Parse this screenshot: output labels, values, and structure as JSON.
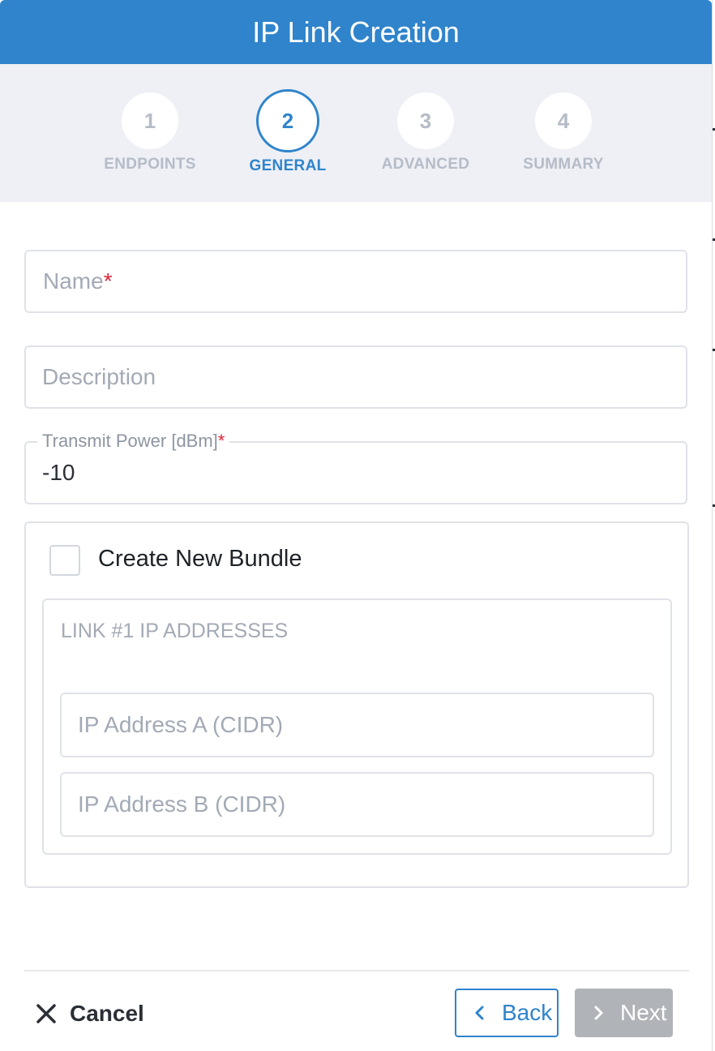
{
  "dialog": {
    "title": "IP Link Creation"
  },
  "stepper": {
    "steps": [
      {
        "number": "1",
        "label": "ENDPOINTS",
        "active": false
      },
      {
        "number": "2",
        "label": "GENERAL",
        "active": true
      },
      {
        "number": "3",
        "label": "ADVANCED",
        "active": false
      },
      {
        "number": "4",
        "label": "SUMMARY",
        "active": false
      }
    ]
  },
  "form": {
    "name": {
      "placeholder": "Name",
      "required_mark": "*",
      "value": ""
    },
    "description": {
      "placeholder": "Description",
      "value": ""
    },
    "transmit_power": {
      "label": "Transmit Power [dBm]",
      "required_mark": "*",
      "value": "-10"
    },
    "bundle": {
      "checkbox_label": "Create New Bundle",
      "checked": false
    },
    "ip_addresses": {
      "title": "LINK #1 IP ADDRESSES",
      "address_a_placeholder": "IP Address A (CIDR)",
      "address_b_placeholder": "IP Address B (CIDR)"
    }
  },
  "footer": {
    "cancel_label": "Cancel",
    "back_label": "Back",
    "next_label": "Next",
    "cancel_icon": "close-icon",
    "back_icon": "chevron-left-icon",
    "next_icon": "chevron-right-icon"
  },
  "colors": {
    "primary": "#2f84cc",
    "stepper_background": "#eef0f5",
    "required": "#e0243a",
    "disabled_button": "#b0b3b8"
  }
}
